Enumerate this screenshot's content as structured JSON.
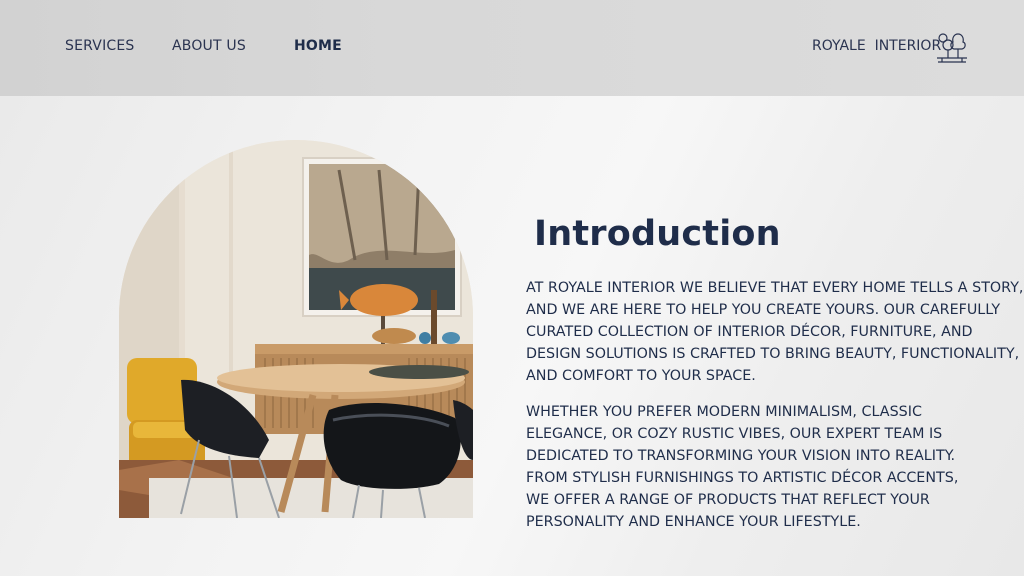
{
  "nav": {
    "services": "SERVICES",
    "about": "ABOUT US",
    "home": "HOME"
  },
  "brand": {
    "name": "ROYALE  INTERIOR",
    "icon": "trees-bench-icon"
  },
  "colors": {
    "navy": "#1f2d4a",
    "topbar": "#d6d6d6",
    "background": "#f2f2f2"
  },
  "hero_image": {
    "description_icon": "dining-room-photo"
  },
  "intro": {
    "title": "Introduction",
    "paragraph1": "AT ROYALE INTERIOR WE BELIEVE THAT EVERY HOME TELLS A STORY,\nAND WE ARE HERE TO HELP YOU CREATE YOURS. OUR CAREFULLY\nCURATED COLLECTION OF INTERIOR DÉCOR, FURNITURE, AND\nDESIGN SOLUTIONS IS CRAFTED TO BRING BEAUTY, FUNCTIONALITY,\nAND COMFORT TO YOUR SPACE.",
    "paragraph2": "WHETHER YOU PREFER MODERN MINIMALISM, CLASSIC\nELEGANCE, OR COZY RUSTIC VIBES, OUR EXPERT TEAM IS\nDEDICATED TO TRANSFORMING YOUR VISION INTO REALITY.\nFROM STYLISH FURNISHINGS TO ARTISTIC DÉCOR ACCENTS,\nWE OFFER A RANGE OF PRODUCTS THAT REFLECT YOUR\nPERSONALITY AND ENHANCE YOUR LIFESTYLE."
  }
}
